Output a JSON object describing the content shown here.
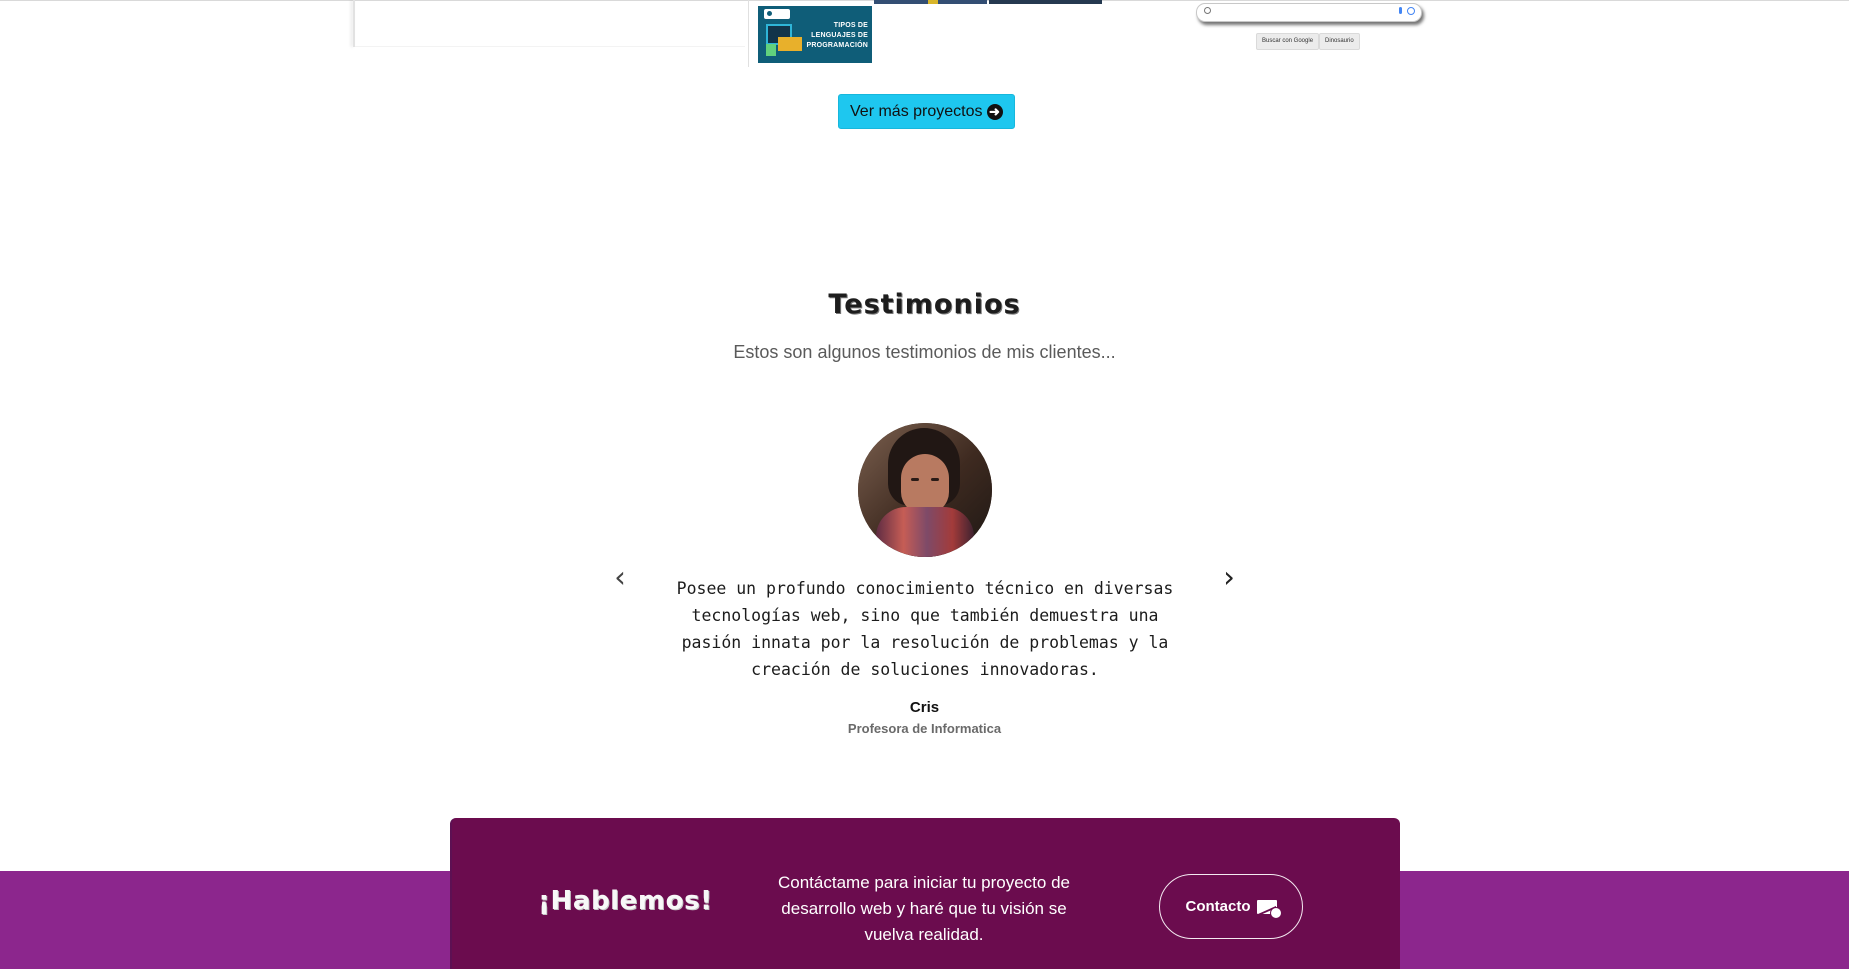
{
  "projects_preview": {
    "thumbnail_text": "TIPOS DE LENGUAJES DE PROGRAMACIÓN",
    "mini_search_google_label": "Buscar con Google",
    "mini_search_dino_label": "Dinosaurio"
  },
  "projects_cta": {
    "label": "Ver más proyectos",
    "icon": "arrow-right-circle-icon"
  },
  "testimonials": {
    "title": "Testimonios",
    "subtitle": "Estos son algunos testimonios de mis clientes...",
    "items": [
      {
        "quote": "Posee un profundo conocimiento técnico en diversas tecnologías web, sino que también demuestra una pasión innata por la resolución de problemas y la creación de soluciones innovadoras.",
        "name": "Cris",
        "role": "Profesora de Informatica"
      }
    ],
    "prev_icon": "chevron-left-icon",
    "next_icon": "chevron-right-icon"
  },
  "contact_section": {
    "title": "¡Hablemos!",
    "text": "Contáctame para iniciar tu proyecto de desarrollo web y haré que tu visión se vuelva realidad.",
    "button_label": "Contacto",
    "button_icon": "mail-check-icon"
  },
  "colors": {
    "accent_cyan": "#1ec7ef",
    "footer_purple": "#8c268d",
    "cta_plum": "#6b0c4e"
  }
}
